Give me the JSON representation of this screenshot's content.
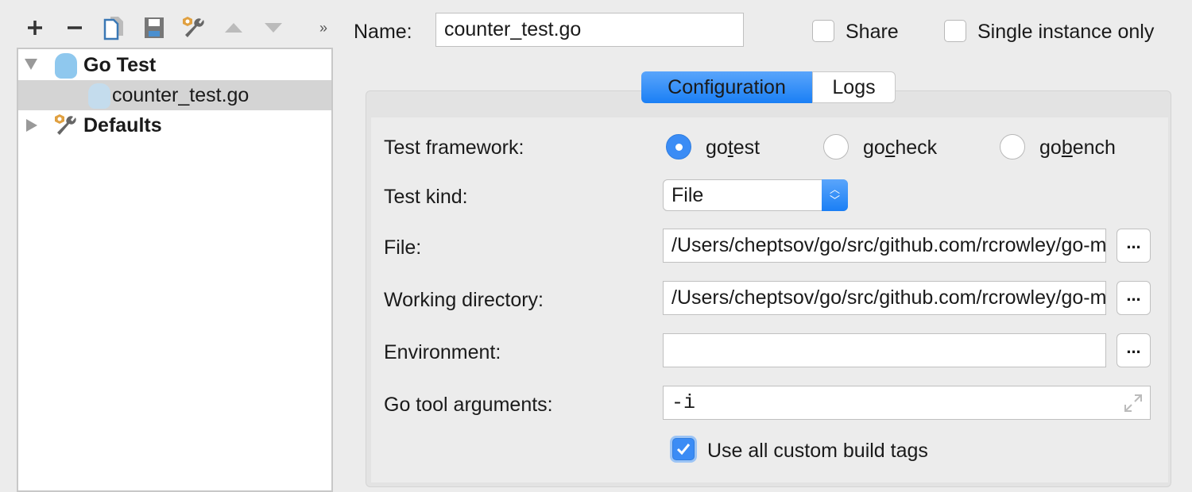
{
  "toolbar": {
    "icons": [
      "plus-icon",
      "minus-icon",
      "copy-icon",
      "save-icon",
      "wrench-icon",
      "arrow-up-icon",
      "arrow-down-icon",
      "more-icon"
    ],
    "more": "»"
  },
  "tree": {
    "items": [
      {
        "label": "Go Test",
        "icon": "gopher-icon",
        "expanded": true
      },
      {
        "label": "counter_test.go",
        "icon": "gopher-icon",
        "selected": true
      },
      {
        "label": "Defaults",
        "icon": "wrench-icon",
        "expanded": false
      }
    ]
  },
  "header": {
    "name_label": "Name:",
    "name_value": "counter_test.go",
    "share_label": "Share",
    "share_checked": false,
    "single_label": "Single instance only",
    "single_checked": false
  },
  "tabs": [
    {
      "label": "Configuration",
      "active": true
    },
    {
      "label": "Logs",
      "active": false
    }
  ],
  "form": {
    "framework_label": "Test framework:",
    "frameworks": [
      {
        "pre": "go",
        "mn": "t",
        "post": "est",
        "selected": true
      },
      {
        "pre": "go",
        "mn": "c",
        "post": "heck",
        "selected": false
      },
      {
        "pre": "go",
        "mn": "b",
        "post": "ench",
        "selected": false
      }
    ],
    "kind_label": "Test kind:",
    "kind_value": "File",
    "file_label": "File:",
    "file_value": "/Users/cheptsov/go/src/github.com/rcrowley/go-metrics/counter_test.go",
    "wd_label": "Working directory:",
    "wd_value": "/Users/cheptsov/go/src/github.com/rcrowley/go-metrics",
    "env_label": "Environment:",
    "env_value": "",
    "args_label": "Go tool arguments:",
    "args_value": "-i",
    "browse": "...",
    "tags_label": "Use all custom build tags",
    "tags_checked": true
  },
  "colors": {
    "accent": "#1a7ff5"
  }
}
